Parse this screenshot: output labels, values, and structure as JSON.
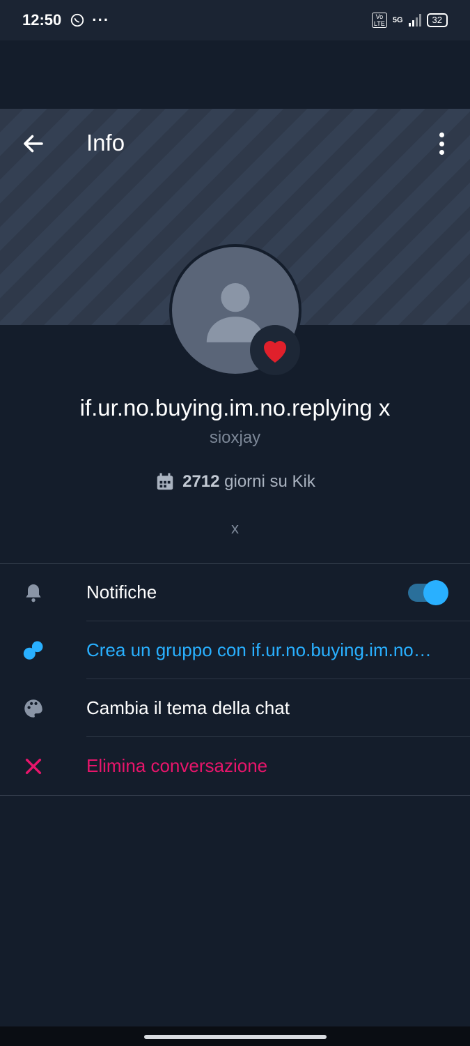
{
  "status_bar": {
    "time": "12:50",
    "network": "5G",
    "volte": "Vo LTE",
    "battery": "32"
  },
  "header": {
    "title": "Info"
  },
  "profile": {
    "display_name": "if.ur.no.buying.im.no.replying x",
    "username": "sioxjay",
    "days_count": "2712",
    "days_text": "giorni su Kik",
    "bio": "x",
    "badge": "heart"
  },
  "menu": {
    "notifications": {
      "label": "Notifiche",
      "enabled": true
    },
    "create_group": {
      "label": "Crea un gruppo con if.ur.no.buying.im.no…"
    },
    "change_theme": {
      "label": "Cambia il tema della chat"
    },
    "delete_chat": {
      "label": "Elimina conversazione"
    }
  },
  "colors": {
    "background": "#141d2b",
    "accent": "#29b0ff",
    "danger": "#e8156b"
  }
}
